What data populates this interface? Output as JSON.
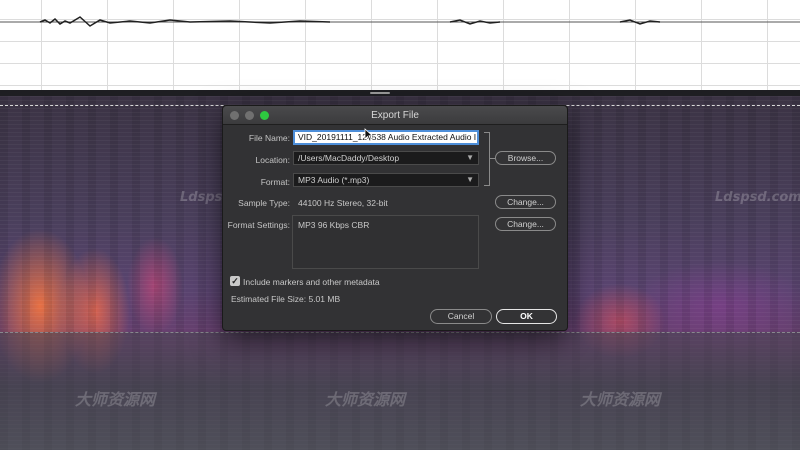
{
  "dialog": {
    "title": "Export File",
    "file_name_label": "File Name:",
    "file_name_value": "VID_20191111_124538 Audio Extracted Audio I",
    "location_label": "Location:",
    "location_value": "/Users/MacDaddy/Desktop",
    "browse_label": "Browse...",
    "format_label": "Format:",
    "format_value": "MP3 Audio (*.mp3)",
    "sample_type_label": "Sample Type:",
    "sample_type_value": "44100 Hz Stereo, 32-bit",
    "sample_change_label": "Change...",
    "format_settings_label": "Format Settings:",
    "format_settings_value": "MP3 96 Kbps CBR",
    "format_change_label": "Change...",
    "metadata_checkbox_label": "Include markers and other metadata",
    "metadata_checked": true,
    "estimated_size": "Estimated File Size: 5.01 MB",
    "cancel_label": "Cancel",
    "ok_label": "OK"
  },
  "colors": {
    "traffic_light_active": "#2ec840",
    "focus_ring": "#4d8ed9",
    "spectrogram_hot": "#ff7a3c"
  },
  "watermarks": {
    "site": "Ldspsd.com",
    "brand": "大师资源网",
    "site_small": "www.Ldspsd.com"
  }
}
